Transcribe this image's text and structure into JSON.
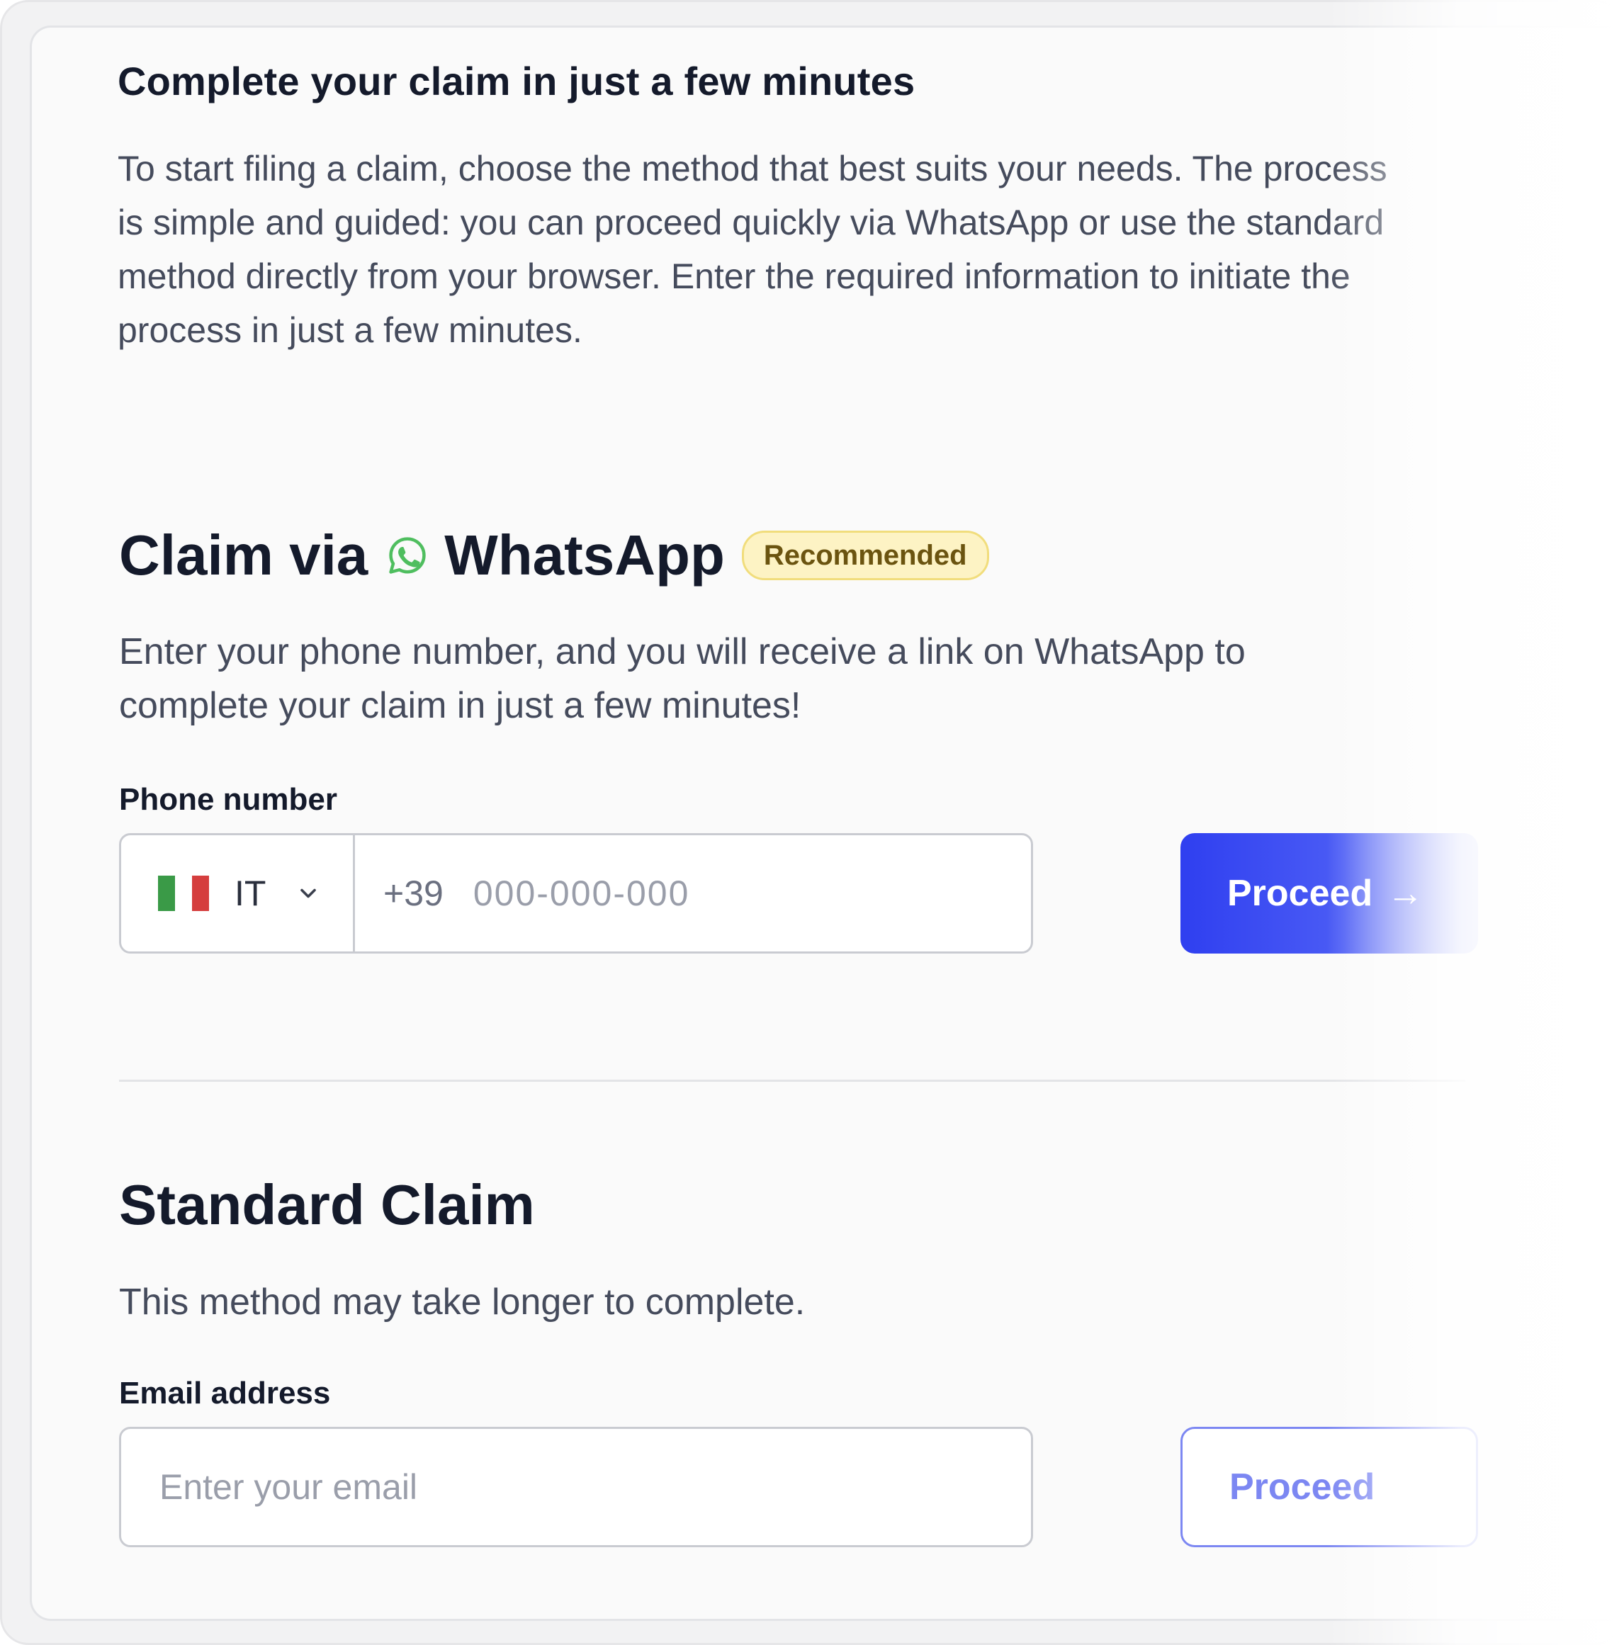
{
  "intro": {
    "title": "Complete your claim in just a few minutes",
    "text": "To start filing a claim, choose the method that best suits your needs. The process is simple and guided: you can proceed quickly via WhatsApp or use the standard method directly from your browser. Enter the required information to initiate the process in just a few minutes."
  },
  "whatsapp": {
    "title_prefix": "Claim via",
    "title_suffix": "WhatsApp",
    "badge": "Recommended",
    "description": "Enter your phone number, and you will receive a link on WhatsApp to complete your claim in just a few minutes!",
    "phone_label": "Phone number",
    "country": {
      "code": "IT",
      "dial_prefix": "+39"
    },
    "phone_placeholder": "000-000-000",
    "phone_value": "",
    "button_label": "Proceed",
    "arrow_icon": "→"
  },
  "standard": {
    "title": "Standard Claim",
    "description": "This method may take longer to complete.",
    "email_label": "Email address",
    "email_placeholder": "Enter your email",
    "email_value": "",
    "button_label": "Proceed"
  },
  "colors": {
    "primary": "#2f3ff0",
    "whatsapp_green": "#4fbe5f",
    "badge_bg": "#fdf3c4",
    "badge_text": "#6b5410"
  }
}
